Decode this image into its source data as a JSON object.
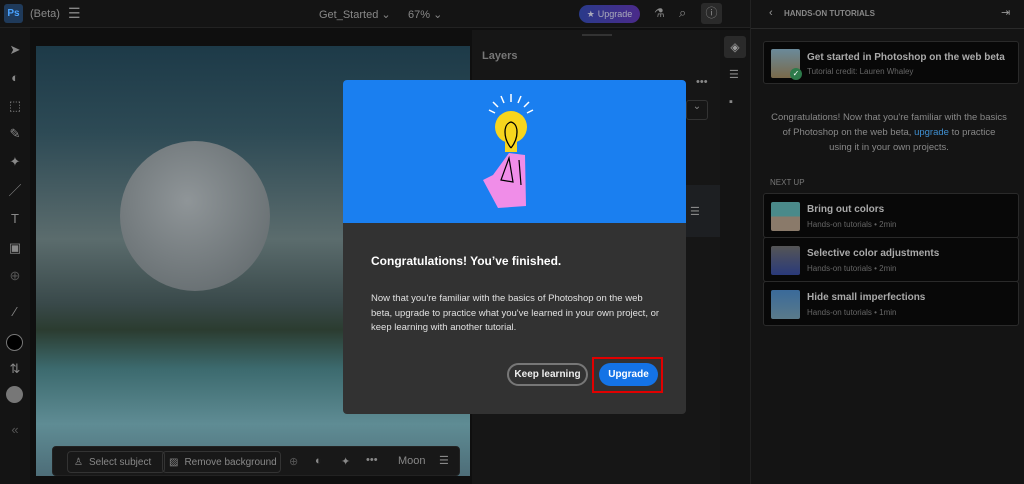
{
  "topbar": {
    "app_badge": "Ps",
    "beta": "(Beta)",
    "document": "Get_Started",
    "zoom": "67%",
    "upgrade": "Upgrade"
  },
  "layers": {
    "title": "Layers"
  },
  "bottom_bar": {
    "select_subject": "Select subject",
    "remove_background": "Remove background",
    "layer_name": "Moon"
  },
  "modal": {
    "title": "Congratulations! You’ve finished.",
    "body": "Now that you're familiar with the basics of Photoshop on the web beta, upgrade to practice what you've learned in your own project, or keep learning with another tutorial.",
    "keep_learning": "Keep learning",
    "upgrade": "Upgrade"
  },
  "tutorials": {
    "header": "HANDS-ON TUTORIALS",
    "current": {
      "title": "Get started in Photoshop on the web beta",
      "credit": "Tutorial credit: Lauren Whaley"
    },
    "congrats_pre": "Congratulations! Now that you're familiar with the basics of Photoshop on the web beta, ",
    "congrats_link": "upgrade",
    "congrats_post": " to practice using it in your own projects.",
    "next_up": "NEXT UP",
    "items": [
      {
        "title": "Bring out colors",
        "meta": "Hands-on tutorials • 2min"
      },
      {
        "title": "Selective color adjustments",
        "meta": "Hands-on tutorials • 2min"
      },
      {
        "title": "Hide small imperfections",
        "meta": "Hands-on tutorials • 1min"
      }
    ]
  },
  "colors": {
    "accent": "#1a7ff0",
    "highlight": "#e00000"
  }
}
